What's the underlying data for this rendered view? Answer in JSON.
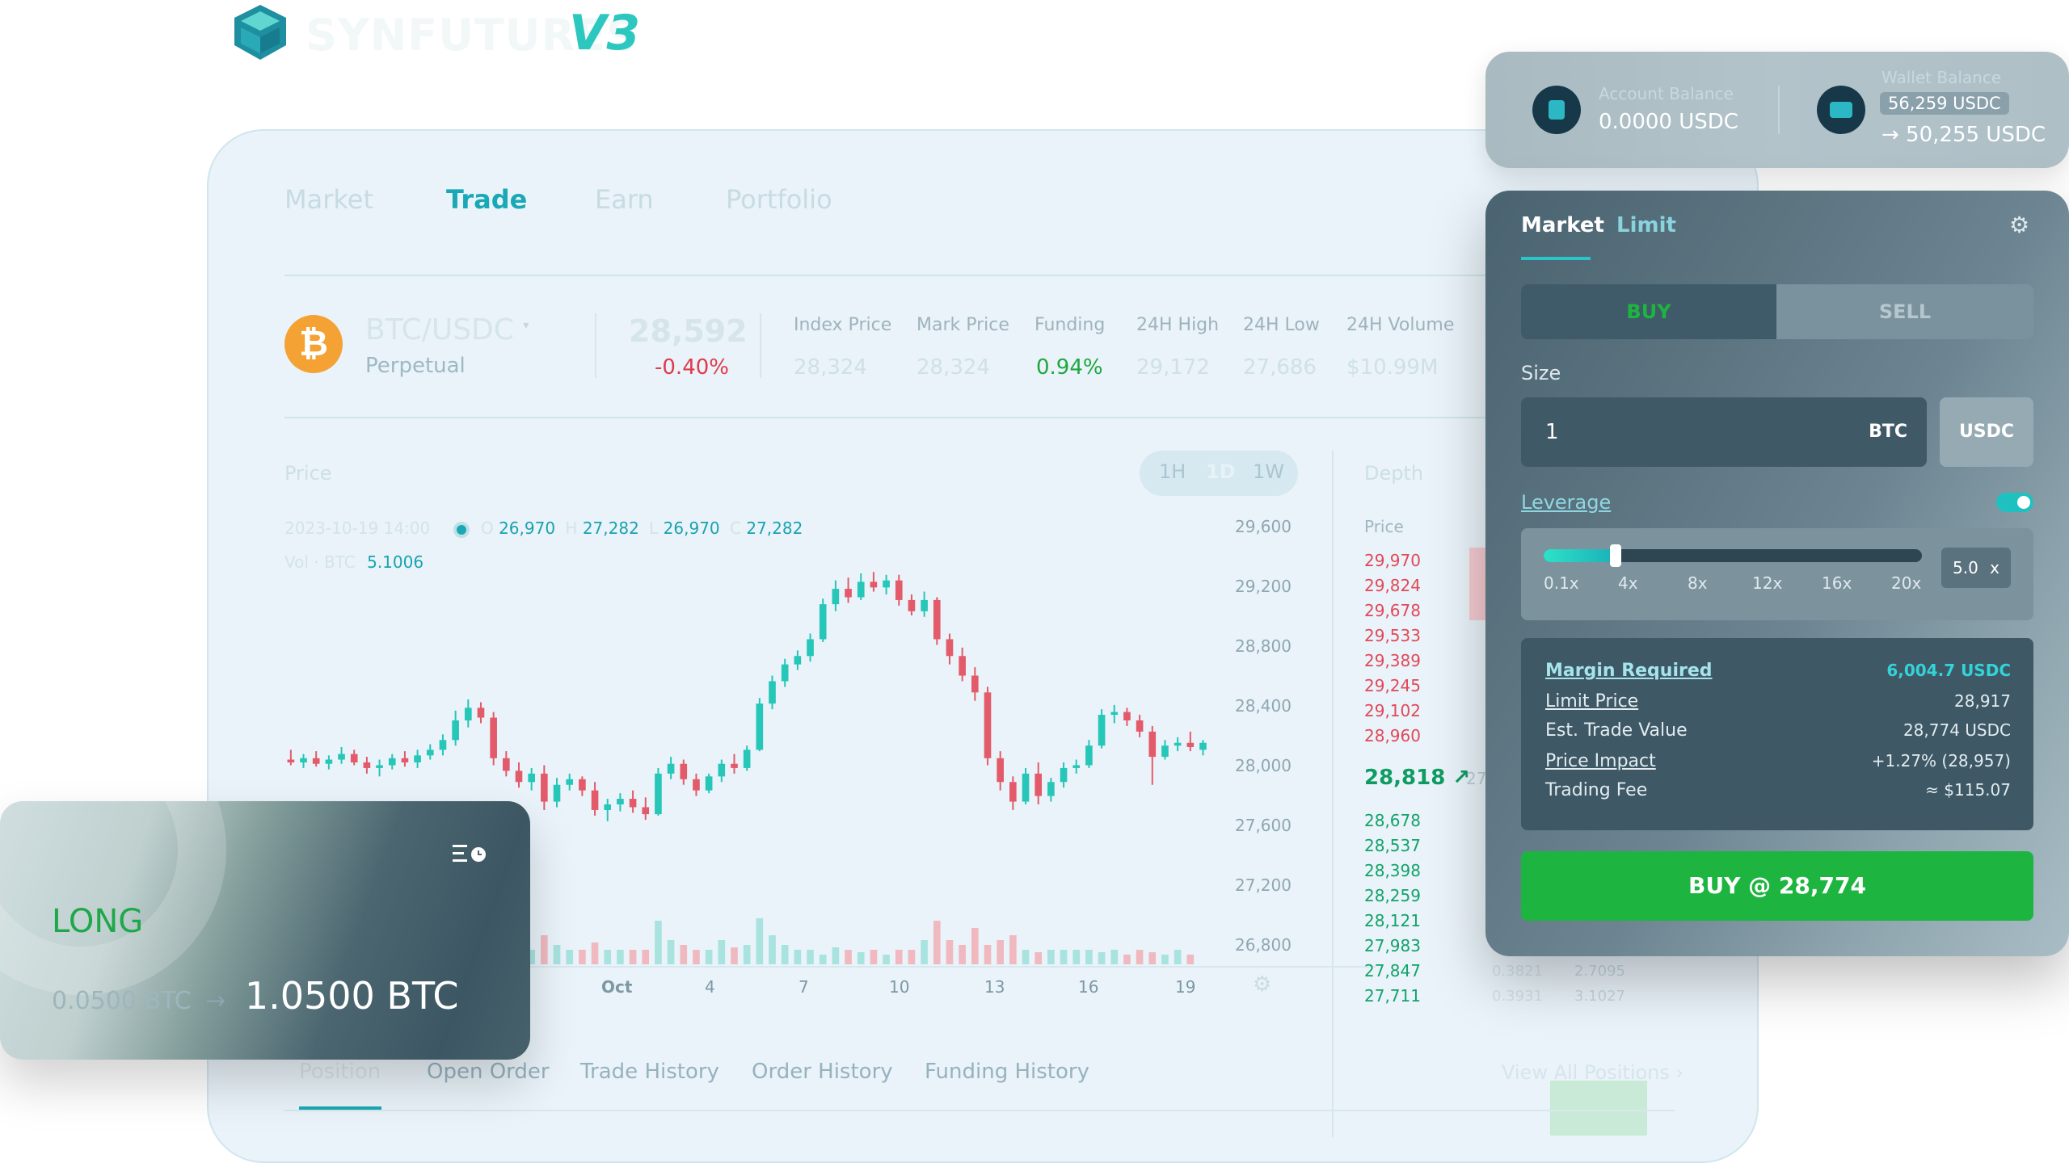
{
  "logo": {
    "brand": "SYNFUTURES",
    "version": "V3"
  },
  "nav": [
    "Market",
    "Trade",
    "Earn",
    "Portfolio"
  ],
  "symbol": {
    "pair": "BTC/USDC",
    "type": "Perpetual",
    "price": "28,592",
    "change": "-0.40%"
  },
  "stats": [
    {
      "label": "Index Price",
      "value": "28,324"
    },
    {
      "label": "Mark Price",
      "value": "28,324"
    },
    {
      "label": "Funding",
      "value": "0.94%"
    },
    {
      "label": "24H High",
      "value": "29,172"
    },
    {
      "label": "24H Low",
      "value": "27,686"
    },
    {
      "label": "24H Volume",
      "value": "$10.99M"
    }
  ],
  "chart": {
    "title": "Price",
    "timeframes": [
      "1H",
      "1D",
      "1W"
    ],
    "ohlc": {
      "time": "2023-10-19 14:00",
      "o_label": "O",
      "o": "26,970",
      "h_label": "H",
      "h": "27,282",
      "l_label": "L",
      "l": "26,970",
      "c_label": "C",
      "c": "27,282"
    },
    "vol_label": "Vol · BTC",
    "vol": "5.1006",
    "y_ticks": [
      "29,600",
      "29,200",
      "28,800",
      "28,400",
      "28,000",
      "27,600",
      "27,200",
      "26,800"
    ],
    "x_ticks": [
      "Oct",
      "4",
      "7",
      "10",
      "13",
      "16",
      "19"
    ],
    "up_color": "#26c6b8",
    "down_color": "#e35a6a"
  },
  "chart_data": {
    "type": "candlestick",
    "ylim": [
      26700,
      29700
    ],
    "candles": [
      {
        "o": 27920,
        "h": 27990,
        "l": 27880,
        "c": 27900
      },
      {
        "o": 27900,
        "h": 27960,
        "l": 27860,
        "c": 27930
      },
      {
        "o": 27930,
        "h": 27980,
        "l": 27870,
        "c": 27890
      },
      {
        "o": 27890,
        "h": 27950,
        "l": 27850,
        "c": 27920
      },
      {
        "o": 27920,
        "h": 28010,
        "l": 27890,
        "c": 27960
      },
      {
        "o": 27960,
        "h": 27990,
        "l": 27880,
        "c": 27900
      },
      {
        "o": 27900,
        "h": 27940,
        "l": 27820,
        "c": 27860
      },
      {
        "o": 27860,
        "h": 27920,
        "l": 27800,
        "c": 27880
      },
      {
        "o": 27880,
        "h": 27960,
        "l": 27850,
        "c": 27930
      },
      {
        "o": 27930,
        "h": 27980,
        "l": 27870,
        "c": 27900
      },
      {
        "o": 27900,
        "h": 27990,
        "l": 27860,
        "c": 27950
      },
      {
        "o": 27950,
        "h": 28030,
        "l": 27920,
        "c": 27990
      },
      {
        "o": 27990,
        "h": 28100,
        "l": 27950,
        "c": 28060
      },
      {
        "o": 28060,
        "h": 28270,
        "l": 28020,
        "c": 28200
      },
      {
        "o": 28200,
        "h": 28350,
        "l": 28150,
        "c": 28290
      },
      {
        "o": 28290,
        "h": 28330,
        "l": 28180,
        "c": 28220
      },
      {
        "o": 28220,
        "h": 28260,
        "l": 27880,
        "c": 27930
      },
      {
        "o": 27930,
        "h": 27980,
        "l": 27800,
        "c": 27840
      },
      {
        "o": 27840,
        "h": 27900,
        "l": 27720,
        "c": 27760
      },
      {
        "o": 27760,
        "h": 27860,
        "l": 27700,
        "c": 27820
      },
      {
        "o": 27820,
        "h": 27880,
        "l": 27560,
        "c": 27620
      },
      {
        "o": 27620,
        "h": 27790,
        "l": 27580,
        "c": 27740
      },
      {
        "o": 27740,
        "h": 27820,
        "l": 27700,
        "c": 27780
      },
      {
        "o": 27780,
        "h": 27800,
        "l": 27660,
        "c": 27700
      },
      {
        "o": 27700,
        "h": 27760,
        "l": 27520,
        "c": 27560
      },
      {
        "o": 27560,
        "h": 27640,
        "l": 27480,
        "c": 27600
      },
      {
        "o": 27600,
        "h": 27680,
        "l": 27550,
        "c": 27640
      },
      {
        "o": 27640,
        "h": 27700,
        "l": 27540,
        "c": 27580
      },
      {
        "o": 27580,
        "h": 27650,
        "l": 27490,
        "c": 27530
      },
      {
        "o": 27530,
        "h": 27860,
        "l": 27520,
        "c": 27820
      },
      {
        "o": 27820,
        "h": 27940,
        "l": 27780,
        "c": 27890
      },
      {
        "o": 27890,
        "h": 27920,
        "l": 27740,
        "c": 27780
      },
      {
        "o": 27780,
        "h": 27820,
        "l": 27660,
        "c": 27700
      },
      {
        "o": 27700,
        "h": 27820,
        "l": 27680,
        "c": 27800
      },
      {
        "o": 27800,
        "h": 27920,
        "l": 27760,
        "c": 27890
      },
      {
        "o": 27890,
        "h": 27960,
        "l": 27820,
        "c": 27860
      },
      {
        "o": 27860,
        "h": 28020,
        "l": 27840,
        "c": 27990
      },
      {
        "o": 27990,
        "h": 28360,
        "l": 27980,
        "c": 28320
      },
      {
        "o": 28320,
        "h": 28520,
        "l": 28280,
        "c": 28480
      },
      {
        "o": 28480,
        "h": 28640,
        "l": 28440,
        "c": 28600
      },
      {
        "o": 28600,
        "h": 28700,
        "l": 28560,
        "c": 28660
      },
      {
        "o": 28660,
        "h": 28820,
        "l": 28620,
        "c": 28780
      },
      {
        "o": 28780,
        "h": 29070,
        "l": 28760,
        "c": 29030
      },
      {
        "o": 29030,
        "h": 29200,
        "l": 28980,
        "c": 29140
      },
      {
        "o": 29140,
        "h": 29220,
        "l": 29040,
        "c": 29080
      },
      {
        "o": 29080,
        "h": 29250,
        "l": 29060,
        "c": 29190
      },
      {
        "o": 29190,
        "h": 29260,
        "l": 29120,
        "c": 29150
      },
      {
        "o": 29150,
        "h": 29240,
        "l": 29100,
        "c": 29200
      },
      {
        "o": 29200,
        "h": 29240,
        "l": 29020,
        "c": 29060
      },
      {
        "o": 29060,
        "h": 29100,
        "l": 28950,
        "c": 28980
      },
      {
        "o": 28980,
        "h": 29120,
        "l": 28940,
        "c": 29060
      },
      {
        "o": 29060,
        "h": 29080,
        "l": 28740,
        "c": 28780
      },
      {
        "o": 28780,
        "h": 28820,
        "l": 28600,
        "c": 28660
      },
      {
        "o": 28660,
        "h": 28720,
        "l": 28480,
        "c": 28520
      },
      {
        "o": 28520,
        "h": 28580,
        "l": 28340,
        "c": 28400
      },
      {
        "o": 28400,
        "h": 28440,
        "l": 27880,
        "c": 27930
      },
      {
        "o": 27930,
        "h": 27980,
        "l": 27700,
        "c": 27760
      },
      {
        "o": 27760,
        "h": 27800,
        "l": 27560,
        "c": 27620
      },
      {
        "o": 27620,
        "h": 27860,
        "l": 27600,
        "c": 27820
      },
      {
        "o": 27820,
        "h": 27900,
        "l": 27600,
        "c": 27660
      },
      {
        "o": 27660,
        "h": 27790,
        "l": 27620,
        "c": 27760
      },
      {
        "o": 27760,
        "h": 27900,
        "l": 27720,
        "c": 27860
      },
      {
        "o": 27860,
        "h": 27920,
        "l": 27820,
        "c": 27880
      },
      {
        "o": 27880,
        "h": 28060,
        "l": 27860,
        "c": 28020
      },
      {
        "o": 28020,
        "h": 28280,
        "l": 28000,
        "c": 28240
      },
      {
        "o": 28240,
        "h": 28310,
        "l": 28180,
        "c": 28260
      },
      {
        "o": 28260,
        "h": 28290,
        "l": 28160,
        "c": 28200
      },
      {
        "o": 28200,
        "h": 28240,
        "l": 28080,
        "c": 28120
      },
      {
        "o": 28120,
        "h": 28160,
        "l": 27740,
        "c": 27940
      },
      {
        "o": 27940,
        "h": 28060,
        "l": 27920,
        "c": 28020
      },
      {
        "o": 28020,
        "h": 28080,
        "l": 27980,
        "c": 28040
      },
      {
        "o": 28040,
        "h": 28120,
        "l": 27980,
        "c": 28010
      },
      {
        "o": 27990,
        "h": 28060,
        "l": 27950,
        "c": 28040
      }
    ],
    "volumes": [
      0.3,
      0.2,
      0.25,
      0.2,
      0.3,
      0.2,
      0.25,
      0.2,
      0.2,
      0.3,
      0.25,
      0.3,
      0.35,
      0.6,
      0.7,
      0.5,
      0.8,
      0.5,
      0.4,
      0.3,
      0.6,
      0.4,
      0.3,
      0.3,
      0.45,
      0.3,
      0.3,
      0.3,
      0.3,
      0.9,
      0.5,
      0.4,
      0.3,
      0.3,
      0.5,
      0.35,
      0.4,
      0.95,
      0.6,
      0.4,
      0.3,
      0.3,
      0.2,
      0.35,
      0.3,
      0.25,
      0.3,
      0.2,
      0.3,
      0.3,
      0.5,
      0.9,
      0.5,
      0.4,
      0.75,
      0.4,
      0.5,
      0.6,
      0.3,
      0.25,
      0.3,
      0.3,
      0.3,
      0.3,
      0.25,
      0.3,
      0.2,
      0.3,
      0.25,
      0.2,
      0.3,
      0.2
    ]
  },
  "depth": {
    "title": "Depth",
    "col_price": "Price",
    "asks": [
      "29,970",
      "29,824",
      "29,678",
      "29,533",
      "29,389",
      "29,245",
      "29,102",
      "28,960"
    ],
    "mid": "28,818 ↗",
    "mid_extra": "27",
    "bids": [
      "28,678",
      "28,537",
      "28,398",
      "28,259",
      "28,121",
      "27,983",
      "27,847",
      "27,711"
    ],
    "bid_sizes": [
      {
        "a": "0.3821",
        "b": "2.7095"
      },
      {
        "a": "0.3931",
        "b": "3.1027"
      }
    ]
  },
  "bottom_tabs": [
    "Position",
    "Open Order",
    "Trade History",
    "Order History",
    "Funding History"
  ],
  "view_all": "View All Positions",
  "long_card": {
    "side": "LONG",
    "from": "0.0500 BTC",
    "arrow": "→",
    "to": "1.0500 BTC"
  },
  "account": {
    "acct_label": "Account Balance",
    "acct_value": "0.0000 USDC",
    "wallet_label": "Wallet Balance",
    "wallet_value": "56,259 USDC",
    "wallet_after": "→ 50,255 USDC"
  },
  "order": {
    "tabs": [
      "Market",
      "Limit"
    ],
    "buy": "BUY",
    "sell": "SELL",
    "size_label": "Size",
    "size_value": "1",
    "size_unit": "BTC",
    "alt_unit": "USDC",
    "leverage_label": "Leverage",
    "lev_ticks": [
      "0.1x",
      "4x",
      "8x",
      "12x",
      "16x",
      "20x"
    ],
    "lev_value": "5.0",
    "lev_unit": "x",
    "lev_level": 0.19,
    "rows": [
      {
        "label": "Margin Required",
        "value": "6,004.7 USDC"
      },
      {
        "label": "Limit Price",
        "value": "28,917"
      },
      {
        "label": "Est. Trade Value",
        "value": "28,774 USDC"
      },
      {
        "label": "Price Impact",
        "value": "+1.27% (28,957)"
      },
      {
        "label": "Trading Fee",
        "value": "≈ $115.07"
      }
    ],
    "submit": "BUY @ 28,774",
    "buy_color": "#1db53f"
  }
}
